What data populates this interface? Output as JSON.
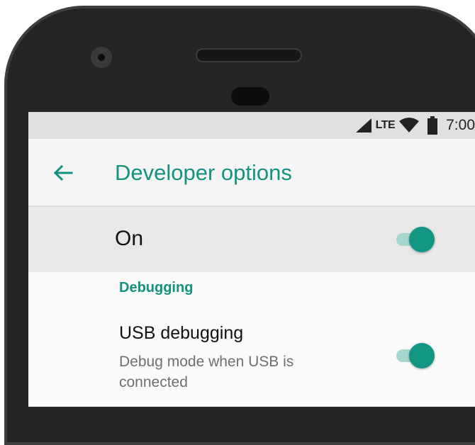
{
  "status_bar": {
    "network_type": "LTE",
    "time": "7:00",
    "icons": [
      "cellular-signal-icon",
      "wifi-icon",
      "battery-icon"
    ]
  },
  "app_bar": {
    "back_icon": "arrow-back-icon",
    "title": "Developer options"
  },
  "master_switch": {
    "label": "On",
    "checked": true
  },
  "sections": [
    {
      "header": "Debugging",
      "items": [
        {
          "title": "USB debugging",
          "summary": "Debug mode when USB is connected",
          "checked": true
        }
      ]
    }
  ],
  "colors": {
    "accent": "#14917f",
    "switch_thumb": "#119683",
    "switch_track": "#a6d6ce",
    "status_bar_bg": "#e0e0e0",
    "app_bar_bg": "#f5f5f5",
    "master_bg": "#e8e8e8",
    "device_frame": "#242424"
  }
}
